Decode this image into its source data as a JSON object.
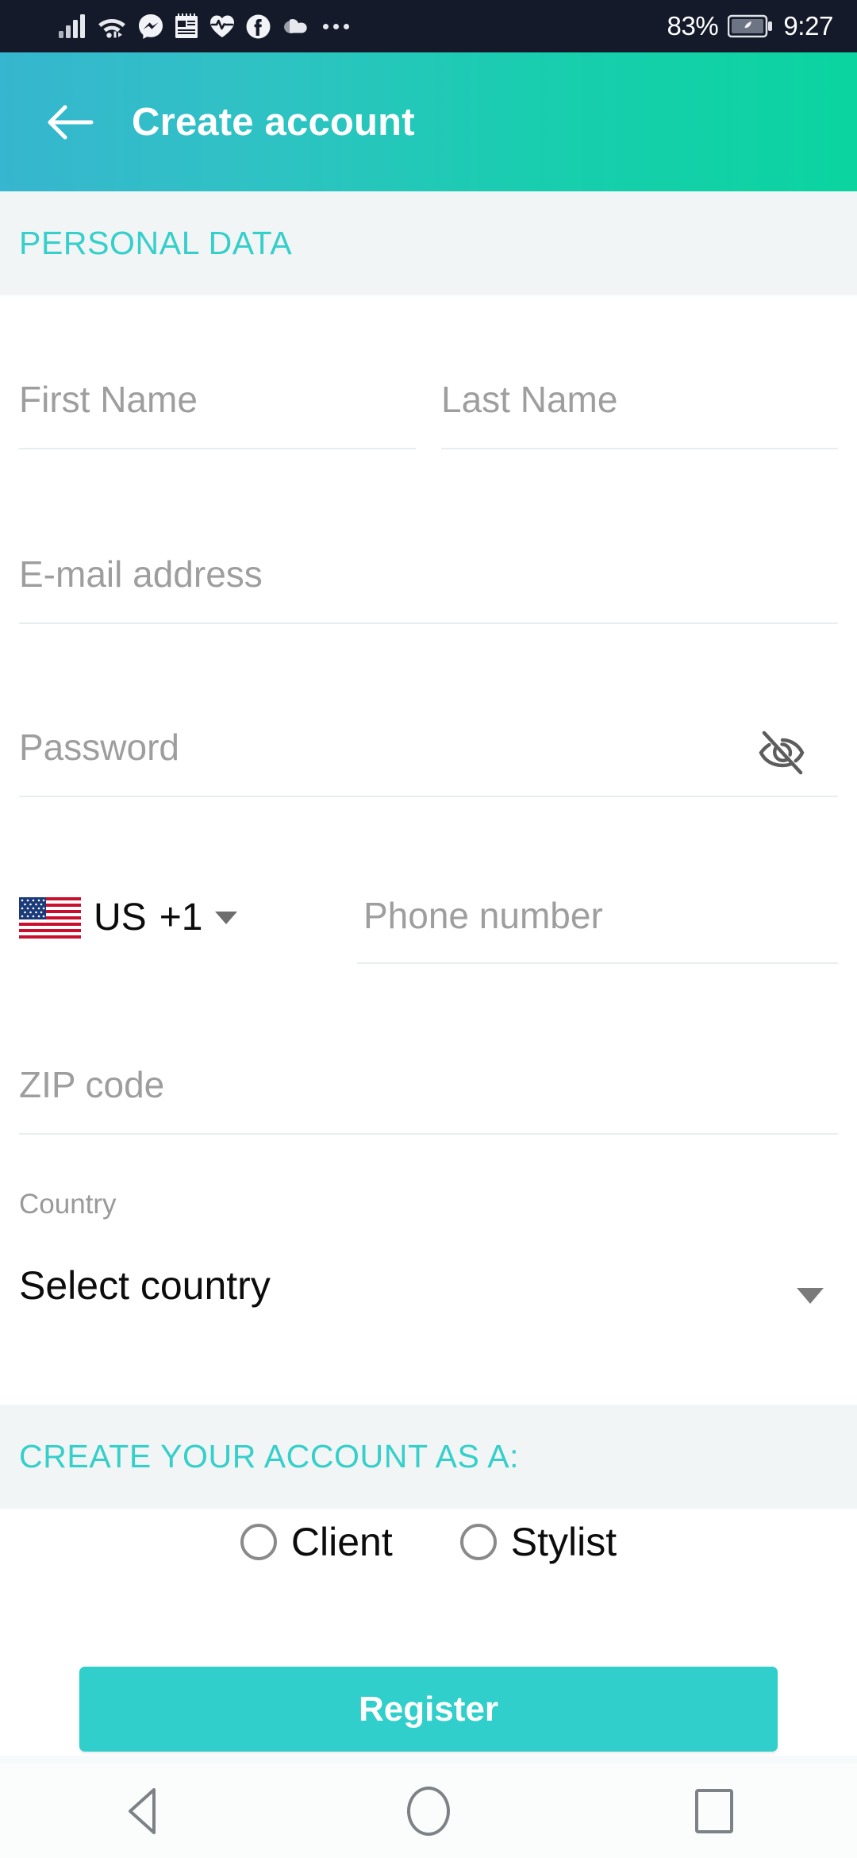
{
  "status_bar": {
    "battery_percent": "83%",
    "clock": "9:27",
    "icons": [
      "signal-bars-icon",
      "wifi-icon",
      "messenger-icon",
      "notes-icon",
      "health-heartbeat-icon",
      "facebook-icon",
      "cloud-icon",
      "overflow-dots-icon"
    ],
    "background": "#141a29"
  },
  "app_bar": {
    "title": "Create account",
    "back_icon": "arrow-left-icon",
    "gradient_start": "#36b6cf",
    "gradient_end": "#0bd4a0"
  },
  "sections": {
    "personal_data": "PERSONAL DATA",
    "account_type": "CREATE YOUR ACCOUNT AS A:"
  },
  "form": {
    "first_name": {
      "value": "",
      "placeholder": "First Name"
    },
    "last_name": {
      "value": "",
      "placeholder": "Last Name"
    },
    "email": {
      "value": "",
      "placeholder": "E-mail address"
    },
    "password": {
      "value": "",
      "placeholder": "Password",
      "toggle_icon": "eye-off-icon"
    },
    "phone": {
      "flag": "us-flag-icon",
      "country_code_label": "US",
      "dial_code": "+1",
      "dropdown_icon": "caret-down-icon",
      "value": "",
      "placeholder": "Phone number"
    },
    "zip": {
      "value": "",
      "placeholder": "ZIP code"
    },
    "country": {
      "label": "Country",
      "selected": "Select country",
      "dropdown_icon": "caret-down-icon"
    }
  },
  "account_type": {
    "options": [
      {
        "label": "Client",
        "selected": false
      },
      {
        "label": "Stylist",
        "selected": false
      }
    ]
  },
  "actions": {
    "register_label": "Register",
    "register_color": "#31cfcb"
  },
  "nav_bar": {
    "back": "nav-back-icon",
    "home": "nav-home-icon",
    "recents": "nav-recents-icon"
  },
  "theme": {
    "accent_teal": "#36cfca",
    "section_bg": "#f1f5f6",
    "placeholder_gray": "#9e9e9e",
    "underline": "#e8eef0"
  }
}
